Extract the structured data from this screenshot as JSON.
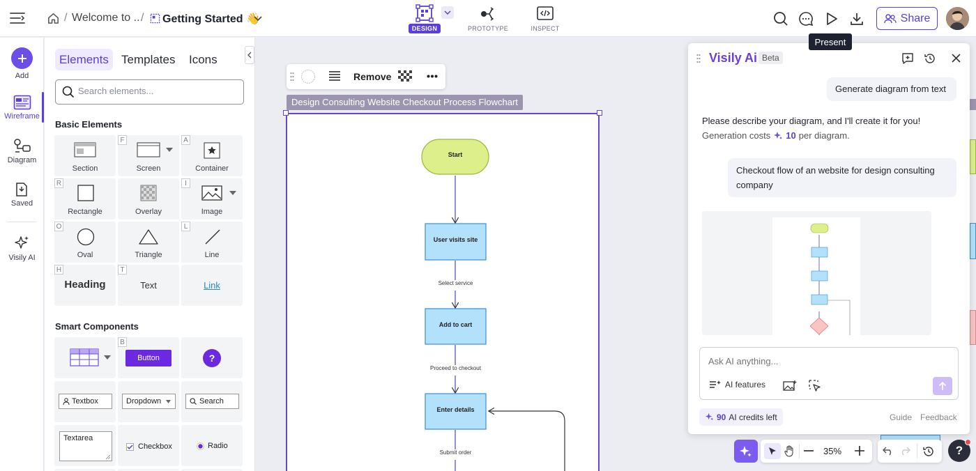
{
  "topbar": {
    "breadcrumb_home": "Welcome to ...",
    "breadcrumb_sep1": "/",
    "breadcrumb_sep2": "/",
    "file_name": "Getting Started 👋",
    "modes": [
      {
        "label": "DESIGN",
        "active": true
      },
      {
        "label": "PROTOTYPE",
        "active": false
      },
      {
        "label": "INSPECT",
        "active": false
      }
    ],
    "share_label": "Share",
    "present_tooltip": "Present"
  },
  "rail": {
    "items": [
      {
        "label": "Add",
        "icon": "plus-icon"
      },
      {
        "label": "Wireframe",
        "icon": "wireframe-icon",
        "active": true
      },
      {
        "label": "Diagram",
        "icon": "diagram-icon"
      },
      {
        "label": "Saved",
        "icon": "saved-icon"
      },
      {
        "label": "Visily AI",
        "icon": "sparkle-icon"
      }
    ]
  },
  "panel": {
    "tabs": [
      "Elements",
      "Templates",
      "Icons"
    ],
    "active_tab": "Elements",
    "search_placeholder": "Search elements...",
    "basic_title": "Basic Elements",
    "basic": [
      {
        "label": "Section",
        "key": ""
      },
      {
        "label": "Screen",
        "key": "F"
      },
      {
        "label": "Container",
        "key": "A"
      },
      {
        "label": "Rectangle",
        "key": "R"
      },
      {
        "label": "Overlay",
        "key": ""
      },
      {
        "label": "Image",
        "key": "I"
      },
      {
        "label": "Oval",
        "key": "O"
      },
      {
        "label": "Triangle",
        "key": ""
      },
      {
        "label": "Line",
        "key": "L"
      },
      {
        "label": "Heading",
        "key": "H"
      },
      {
        "label": "Text",
        "key": "T"
      },
      {
        "label": "Link",
        "key": ""
      }
    ],
    "smart_title": "Smart Components",
    "smart": {
      "button_key": "B",
      "button_label": "Button",
      "help_label": "?",
      "textbox_label": "Textbox",
      "dropdown_label": "Dropdown",
      "search_label": "Search",
      "textarea_label": "Textarea",
      "checkbox_label": "Checkbox",
      "radio_label": "Radio"
    }
  },
  "canvas": {
    "toolbar_remove": "Remove",
    "frame_label": "Design Consulting Website Checkout Process Flowchart",
    "flow": {
      "start": "Start",
      "step1": "User visits site",
      "edge1": "Select service",
      "step2": "Add to cart",
      "edge2": "Proceed to checkout",
      "step3": "Enter details",
      "edge3": "Submit order"
    }
  },
  "ai": {
    "title": "Visily Ai",
    "beta": "Beta",
    "user_msg_1": "Generate diagram from text",
    "assistant_msg": "Please describe your diagram, and I'll create it for you!",
    "cost_prefix": "Generation costs",
    "cost_value": "10",
    "cost_suffix": "per diagram.",
    "user_msg_2": "Checkout flow of an website for design consulting company",
    "ask_placeholder": "Ask AI anything...",
    "ai_features": "AI features",
    "credits_value": "90",
    "credits_label": "AI credits left",
    "guide": "Guide",
    "feedback": "Feedback"
  },
  "zoom": {
    "value": "35%"
  },
  "colors": {
    "accent": "#5b3fd6",
    "start_node": "#dcef8a",
    "process_node": "#b3e0fb",
    "decision_node": "#f9c4c4"
  }
}
